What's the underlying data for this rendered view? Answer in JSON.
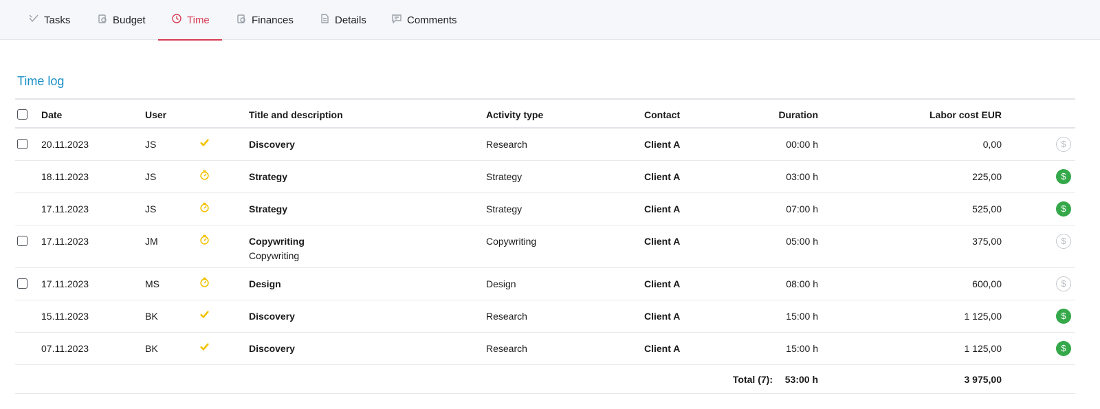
{
  "tabs": [
    {
      "label": "Tasks",
      "icon": "check-icon",
      "active": false
    },
    {
      "label": "Budget",
      "icon": "budget-icon",
      "active": false
    },
    {
      "label": "Time",
      "icon": "clock-icon",
      "active": true
    },
    {
      "label": "Finances",
      "icon": "finances-icon",
      "active": false
    },
    {
      "label": "Details",
      "icon": "document-icon",
      "active": false
    },
    {
      "label": "Comments",
      "icon": "comment-icon",
      "active": false
    }
  ],
  "section_title": "Time log",
  "columns": {
    "date": "Date",
    "user": "User",
    "title": "Title and description",
    "activity": "Activity type",
    "contact": "Contact",
    "duration": "Duration",
    "labor": "Labor cost EUR"
  },
  "rows": [
    {
      "checkbox": true,
      "date": "20.11.2023",
      "user": "JS",
      "status": "approved",
      "title": "Discovery",
      "description": "",
      "activity": "Research",
      "contact": "Client A",
      "duration": "00:00 h",
      "labor": "0,00",
      "billed": false
    },
    {
      "checkbox": false,
      "date": "18.11.2023",
      "user": "JS",
      "status": "timer",
      "title": "Strategy",
      "description": "",
      "activity": "Strategy",
      "contact": "Client A",
      "duration": "03:00 h",
      "labor": "225,00",
      "billed": true
    },
    {
      "checkbox": false,
      "date": "17.11.2023",
      "user": "JS",
      "status": "timer",
      "title": "Strategy",
      "description": "",
      "activity": "Strategy",
      "contact": "Client A",
      "duration": "07:00 h",
      "labor": "525,00",
      "billed": true
    },
    {
      "checkbox": true,
      "date": "17.11.2023",
      "user": "JM",
      "status": "timer",
      "title": "Copywriting",
      "description": "Copywriting",
      "activity": "Copywriting",
      "contact": "Client A",
      "duration": "05:00 h",
      "labor": "375,00",
      "billed": false
    },
    {
      "checkbox": true,
      "date": "17.11.2023",
      "user": "MS",
      "status": "timer",
      "title": "Design",
      "description": "",
      "activity": "Design",
      "contact": "Client A",
      "duration": "08:00 h",
      "labor": "600,00",
      "billed": false
    },
    {
      "checkbox": false,
      "date": "15.11.2023",
      "user": "BK",
      "status": "approved",
      "title": "Discovery",
      "description": "",
      "activity": "Research",
      "contact": "Client A",
      "duration": "15:00 h",
      "labor": "1 125,00",
      "billed": true
    },
    {
      "checkbox": false,
      "date": "07.11.2023",
      "user": "BK",
      "status": "approved",
      "title": "Discovery",
      "description": "",
      "activity": "Research",
      "contact": "Client A",
      "duration": "15:00 h",
      "labor": "1 125,00",
      "billed": true
    }
  ],
  "total": {
    "label": "Total (7):",
    "duration": "53:00 h",
    "labor": "3 975,00"
  },
  "colors": {
    "accent": "#d83a52",
    "title": "#1a8fc7",
    "status_yellow": "#f2c200",
    "paid_green": "#35a84a"
  },
  "money_symbol": "$"
}
